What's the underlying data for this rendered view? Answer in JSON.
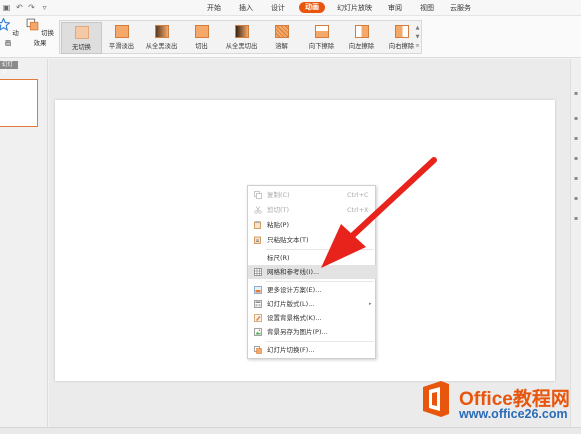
{
  "menubar": {
    "tabs": [
      "开始",
      "插入",
      "设计",
      "动画",
      "幻灯片放映",
      "审阅",
      "视图",
      "云服务"
    ],
    "active_tab": "动画"
  },
  "ribbon": {
    "animation_label": "动画",
    "transition_effect_label": "切换效果",
    "transitions": [
      "无切换",
      "平滑淡出",
      "从全黑淡出",
      "切出",
      "从全黑切出",
      "溶解",
      "向下擦除",
      "向左擦除",
      "向右擦除"
    ],
    "selected_transition": "无切换"
  },
  "left_panel": {
    "tab_label": "幻灯片"
  },
  "context_menu": {
    "items": [
      {
        "label": "复制(C)",
        "shortcut": "Ctrl+C",
        "disabled": true,
        "icon": "copy-icon"
      },
      {
        "label": "剪切(T)",
        "shortcut": "Ctrl+X",
        "disabled": true,
        "icon": "scissors-icon"
      },
      {
        "label": "粘贴(P)",
        "shortcut": "",
        "disabled": false,
        "icon": "paste-icon"
      },
      {
        "label": "只粘贴文本(T)",
        "shortcut": "",
        "disabled": false,
        "icon": "paste-text-icon"
      },
      {
        "label": "标尺(R)",
        "shortcut": "",
        "disabled": false,
        "icon": ""
      },
      {
        "label": "网格和参考线(I)...",
        "shortcut": "",
        "disabled": false,
        "icon": "grid-icon",
        "highlighted": true
      },
      {
        "label": "更多设计方案(E)...",
        "shortcut": "",
        "disabled": false,
        "icon": "design-icon"
      },
      {
        "label": "幻灯片版式(L)...",
        "shortcut": "",
        "disabled": false,
        "icon": "layout-icon",
        "submenu": true
      },
      {
        "label": "设置背景格式(K)...",
        "shortcut": "",
        "disabled": false,
        "icon": "background-icon"
      },
      {
        "label": "背景另存为图片(P)...",
        "shortcut": "",
        "disabled": false,
        "icon": "save-image-icon"
      },
      {
        "label": "幻灯片切换(F)...",
        "shortcut": "",
        "disabled": false,
        "icon": "transition-icon"
      }
    ]
  },
  "watermark": {
    "brand": "Office教程网",
    "url": "www.office26.com"
  },
  "colors": {
    "accent": "#e8560e",
    "arrow": "#e8231c",
    "url_blue": "#2b6cb8"
  }
}
